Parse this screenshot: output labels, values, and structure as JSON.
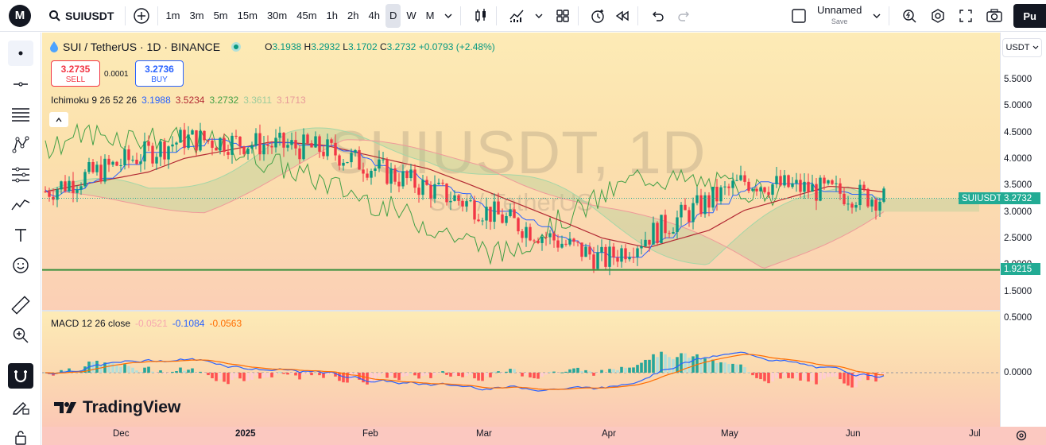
{
  "topbar": {
    "logo_letter": "M",
    "symbol": "SUIUSDT",
    "timeframes": [
      "1m",
      "3m",
      "5m",
      "15m",
      "30m",
      "45m",
      "1h",
      "2h",
      "4h",
      "D",
      "W",
      "M"
    ],
    "active_timeframe": "D",
    "layout_name": "Unnamed",
    "layout_sub": "Save",
    "publish_label": "Pu"
  },
  "legend": {
    "title": "SUI / TetherUS · 1D · BINANCE",
    "o_label": "O",
    "o": "3.1938",
    "h_label": "H",
    "h": "3.2932",
    "l_label": "L",
    "l": "3.1702",
    "c_label": "C",
    "c": "3.2732",
    "change": "+0.0793 (+2.48%)"
  },
  "trade": {
    "sell_price": "3.2735",
    "sell_label": "SELL",
    "buy_price": "3.2736",
    "buy_label": "BUY",
    "spread": "0.0001"
  },
  "ichimoku": {
    "name": "Ichimoku 9 26 52 26",
    "conversion": "3.1988",
    "base": "3.5234",
    "lagging": "3.2732",
    "lead1": "3.3611",
    "lead2": "3.1713",
    "colors": {
      "conversion": "#2962ff",
      "base": "#b22833",
      "lagging": "#43a047",
      "lead_a": "#a5d6a7",
      "lead_b": "#ef9a9a"
    }
  },
  "macd": {
    "name": "MACD 12 26 close",
    "histogram": "-0.0521",
    "macd": "-0.1084",
    "signal": "-0.0563",
    "colors": {
      "macd": "#2962ff",
      "signal": "#ff6d00",
      "hist_pos": "#26a69a",
      "hist_neg": "#ff5252"
    }
  },
  "watermark": {
    "symbol": "SUIUSDT, 1D",
    "name": "SUI / TetherUS"
  },
  "currency": "USDT",
  "price_axis": [
    "5.5000",
    "5.0000",
    "4.5000",
    "4.0000",
    "3.5000",
    "3.0000",
    "2.5000",
    "2.0000",
    "1.5000"
  ],
  "macd_axis": [
    "0.5000",
    "0.0000"
  ],
  "price_tags": {
    "symbol_label": "SUIUSDT",
    "last_price": "3.2732",
    "horizontal_line": "1.9215"
  },
  "time_axis": [
    "Dec",
    "2025",
    "Feb",
    "Mar",
    "Apr",
    "May",
    "Jun",
    "Jul"
  ],
  "brand": "TradingView",
  "chart_data": {
    "type": "line",
    "title": "SUI / TetherUS · 1D · BINANCE",
    "x": [
      "Dec",
      "2025",
      "Feb",
      "Mar",
      "Apr",
      "May",
      "Jun"
    ],
    "series": [
      {
        "name": "Close",
        "values": [
          3.4,
          4.4,
          4.2,
          3.2,
          2.1,
          3.6,
          3.27
        ]
      }
    ],
    "ylim": [
      1.2,
      5.7
    ],
    "horizontal_line": 1.9215,
    "last": 3.2732
  }
}
